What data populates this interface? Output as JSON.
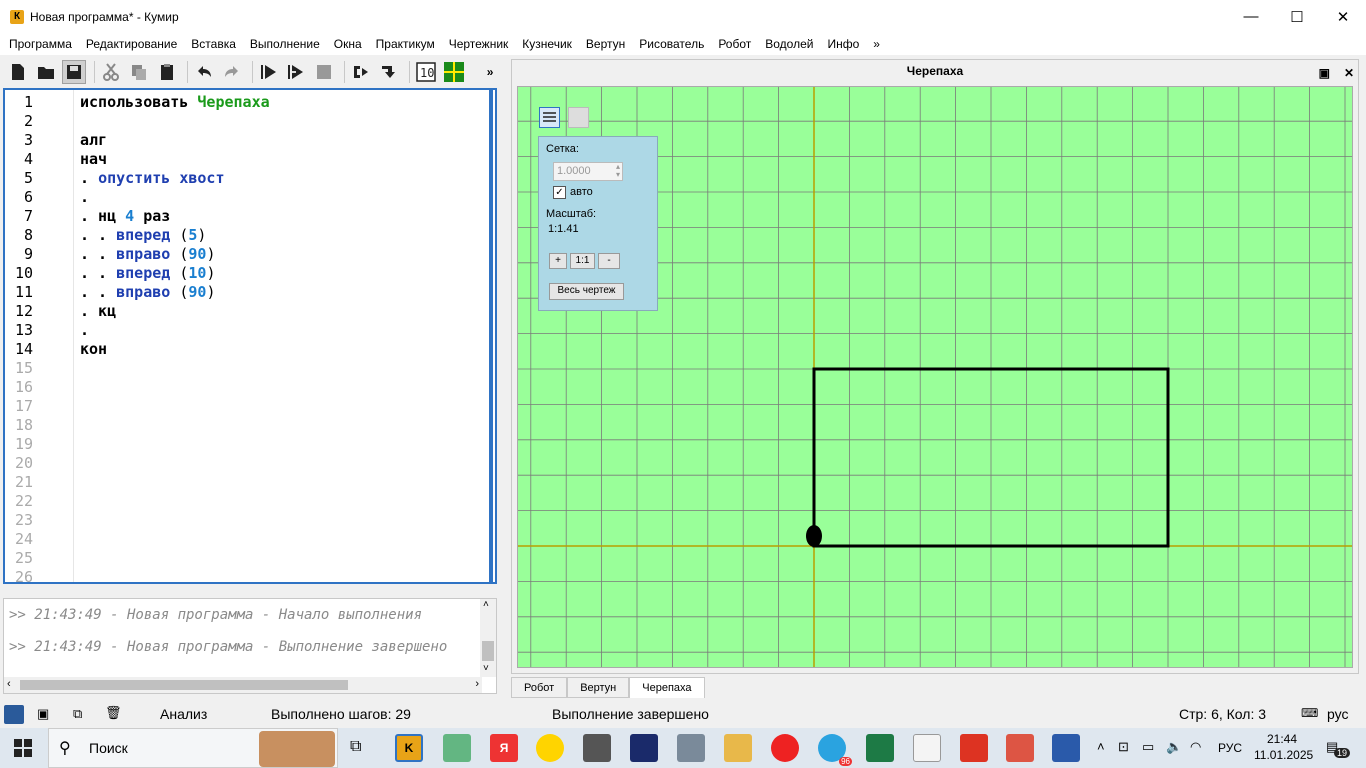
{
  "window": {
    "title": "Новая программа* - Кумир",
    "app_icon": "К"
  },
  "window_controls": {
    "minimize": "—",
    "maximize": "☐",
    "close": "✕"
  },
  "menu": [
    "Программа",
    "Редактирование",
    "Вставка",
    "Выполнение",
    "Окна",
    "Практикум",
    "Чертежник",
    "Кузнечик",
    "Вертун",
    "Рисователь",
    "Робот",
    "Водолей",
    "Инфо",
    "»"
  ],
  "toolbar": {
    "overflow": "»"
  },
  "editor": {
    "line_numbers": [
      "1",
      "2",
      "3",
      "4",
      "5",
      "6",
      "7",
      "8",
      "9",
      "10",
      "11",
      "12",
      "13",
      "14",
      "15",
      "16",
      "17",
      "18",
      "19",
      "20",
      "21",
      "22",
      "23",
      "24",
      "25",
      "26"
    ],
    "lines": [
      {
        "parts": [
          {
            "t": "использовать ",
            "c": "kw"
          },
          {
            "t": "Черепаха",
            "c": "lib"
          }
        ]
      },
      {
        "parts": []
      },
      {
        "parts": [
          {
            "t": "алг",
            "c": "kw"
          }
        ]
      },
      {
        "parts": [
          {
            "t": "нач",
            "c": "kw"
          }
        ]
      },
      {
        "parts": [
          {
            "t": ". ",
            "c": "kw"
          },
          {
            "t": "опустить хвост",
            "c": "fn"
          }
        ]
      },
      {
        "parts": [
          {
            "t": ".",
            "c": "kw"
          }
        ]
      },
      {
        "parts": [
          {
            "t": ". нц ",
            "c": "kw"
          },
          {
            "t": "4",
            "c": "num"
          },
          {
            "t": " раз",
            "c": "kw"
          }
        ]
      },
      {
        "parts": [
          {
            "t": ". . ",
            "c": "kw"
          },
          {
            "t": "вперед",
            "c": "fn"
          },
          {
            "t": " (",
            "c": "br"
          },
          {
            "t": "5",
            "c": "num"
          },
          {
            "t": ")",
            "c": "br"
          }
        ]
      },
      {
        "parts": [
          {
            "t": ". . ",
            "c": "kw"
          },
          {
            "t": "вправо",
            "c": "fn"
          },
          {
            "t": " (",
            "c": "br"
          },
          {
            "t": "90",
            "c": "num"
          },
          {
            "t": ")",
            "c": "br"
          }
        ]
      },
      {
        "parts": [
          {
            "t": ". . ",
            "c": "kw"
          },
          {
            "t": "вперед",
            "c": "fn"
          },
          {
            "t": " (",
            "c": "br"
          },
          {
            "t": "10",
            "c": "num"
          },
          {
            "t": ")",
            "c": "br"
          }
        ]
      },
      {
        "parts": [
          {
            "t": ". . ",
            "c": "kw"
          },
          {
            "t": "вправо",
            "c": "fn"
          },
          {
            "t": " (",
            "c": "br"
          },
          {
            "t": "90",
            "c": "num"
          },
          {
            "t": ")",
            "c": "br"
          }
        ]
      },
      {
        "parts": [
          {
            "t": ". кц",
            "c": "kw"
          }
        ]
      },
      {
        "parts": [
          {
            "t": ".",
            "c": "kw"
          }
        ]
      },
      {
        "parts": [
          {
            "t": "кон",
            "c": "kw"
          }
        ]
      }
    ]
  },
  "console": {
    "lines": [
      ">> 21:43:49 - Новая программа - Начало выполнения",
      ">> 21:43:49 - Новая программа - Выполнение завершено"
    ]
  },
  "turtle": {
    "title": "Черепаха",
    "grid_label": "Сетка:",
    "grid_value": "1.0000",
    "auto_label": "авто",
    "auto_checked": true,
    "scale_label": "Масштаб:",
    "scale_value": "1:1.41",
    "zoom_in": "+",
    "zoom_reset": "1:1",
    "zoom_out": "-",
    "fit_all": "Весь чертеж",
    "drawing": {
      "steps_forward": [
        5,
        10
      ],
      "turn": 90,
      "repeat": 4
    }
  },
  "tabs": [
    {
      "label": "Робот",
      "selected": false
    },
    {
      "label": "Вертун",
      "selected": false
    },
    {
      "label": "Черепаха",
      "selected": true
    }
  ],
  "status": {
    "mode": "Анализ",
    "steps": "Выполнено шагов: 29",
    "state": "Выполнение завершено",
    "cursor": "Стр: 6, Кол: 3",
    "lang": "рус"
  },
  "taskbar": {
    "search": "Поиск",
    "lang": "РУС",
    "time": "21:44",
    "date": "11.01.2025",
    "notifications": "19",
    "telegram_badge": "96"
  },
  "colors": {
    "canvas": "#99ff99",
    "grid": "#7a7a7a",
    "axis": "#b8a000",
    "editor_border": "#2f73c4"
  }
}
